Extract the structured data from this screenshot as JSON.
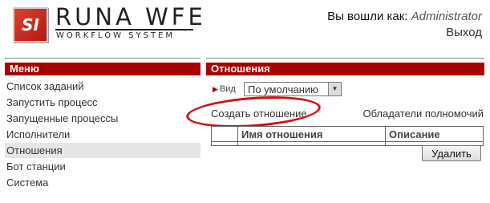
{
  "logo": {
    "badge": "SI",
    "name": "RUNA WFE",
    "subtitle": "WORKFLOW SYSTEM"
  },
  "user": {
    "prefix": "Вы вошли как:",
    "name": "Administrator",
    "logout": "Выход"
  },
  "menu": {
    "title": "Меню",
    "items": [
      {
        "label": "Список заданий"
      },
      {
        "label": "Запустить процесс"
      },
      {
        "label": "Запущенные процессы"
      },
      {
        "label": "Исполнители"
      },
      {
        "label": "Отношения"
      },
      {
        "label": "Бот станции"
      },
      {
        "label": "Система"
      }
    ],
    "active_item": "Отношения"
  },
  "main": {
    "title": "Отношения",
    "view_label": "Вид",
    "view_selected": "По умолчанию",
    "create_link": "Создать отношение",
    "permissions_link": "Обладатели полномочий",
    "table": {
      "columns": [
        "",
        "Имя отношения",
        "Описание"
      ],
      "rows": []
    },
    "delete_button": "Удалить"
  },
  "colors": {
    "header_bar": "#a90000",
    "highlight_ellipse": "#d01010",
    "active_menu_bg": "#e6e6e6"
  }
}
